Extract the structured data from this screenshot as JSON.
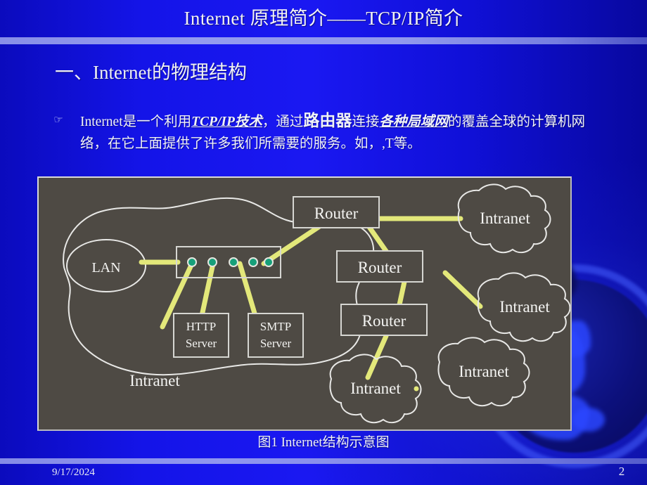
{
  "slide": {
    "title": "Internet 原理简介——TCP/IP简介",
    "section_heading": "一、Internet的物理结构",
    "bullet_marker": "☞",
    "bullet": {
      "seg1": "Internet是一个利用",
      "seg2_emph": "TCP/IP技术",
      "seg3": "，通过",
      "seg4_emph": "路由器",
      "seg5": "连接",
      "seg6_emph": "各种局域网",
      "seg7": "的覆盖全球的计算机网络，在它上面提供了许多我们所需要的服务。如，",
      "seg8": ",T等。"
    },
    "figure_caption": "图1 Internet结构示意图",
    "footer": {
      "date": "9/17/2024",
      "page_number": "2"
    },
    "colors": {
      "background_blue": "#1414e8",
      "panel_gray": "#4e4a44",
      "link_yellow": "#e3e87a",
      "port_teal": "#17a07a",
      "outline_white": "#e8e8e6",
      "rule_periwinkle": "#9aa2ef"
    }
  },
  "diagram": {
    "title": "Internet结构示意图",
    "enclosure_label": "Intranet",
    "lan_label": "LAN",
    "hub_ports": 5,
    "nodes": [
      {
        "id": "router-top",
        "label": "Router",
        "type": "box"
      },
      {
        "id": "router-mid",
        "label": "Router",
        "type": "box"
      },
      {
        "id": "router-bottom",
        "label": "Router",
        "type": "box"
      },
      {
        "id": "http-server",
        "label": "HTTP Server",
        "type": "box",
        "line1": "HTTP",
        "line2": "Server"
      },
      {
        "id": "smtp-server",
        "label": "SMTP Server",
        "type": "box",
        "line1": "SMTP",
        "line2": "Server"
      },
      {
        "id": "intranet-1",
        "label": "Intranet",
        "type": "cloud"
      },
      {
        "id": "intranet-2",
        "label": "Intranet",
        "type": "cloud"
      },
      {
        "id": "intranet-3",
        "label": "Intranet",
        "type": "cloud"
      },
      {
        "id": "intranet-4",
        "label": "Intranet",
        "type": "cloud"
      }
    ],
    "links": [
      {
        "from": "lan",
        "to": "hub-port-1"
      },
      {
        "from": "hub-port-2",
        "to": "http-server"
      },
      {
        "from": "hub-port-3",
        "to": "http-server"
      },
      {
        "from": "hub-port-4",
        "to": "smtp-server"
      },
      {
        "from": "hub-port-5",
        "to": "router-top"
      },
      {
        "from": "router-top",
        "to": "intranet-1"
      },
      {
        "from": "router-top",
        "to": "router-mid"
      },
      {
        "from": "router-mid",
        "to": "intranet-2"
      },
      {
        "from": "router-mid",
        "to": "router-bottom"
      },
      {
        "from": "router-bottom",
        "to": "intranet-3"
      }
    ]
  }
}
